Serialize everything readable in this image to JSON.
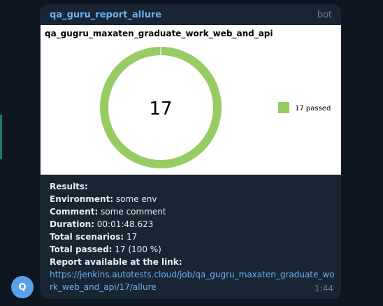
{
  "message": {
    "sender": "qa_guru_report_allure",
    "badge": "bot",
    "time": "1:44"
  },
  "avatar": {
    "letter": "Q"
  },
  "report": {
    "title": "qa_gugru_maxaten_graduate_work_web_and_api",
    "center_label": "17",
    "legend_label": "17 passed"
  },
  "chart_data": {
    "type": "pie",
    "title": "qa_gugru_maxaten_graduate_work_web_and_api",
    "center_label": "17",
    "series": [
      {
        "name": "17 passed",
        "value": 17,
        "color": "#97cc64"
      }
    ],
    "legend_position": "right"
  },
  "results": {
    "heading": "Results:",
    "environment_label": "Environment:",
    "environment_value": " some env",
    "comment_label": "Comment:",
    "comment_value": " some comment",
    "duration_label": "Duration:",
    "duration_value": " 00:01:48.623",
    "total_scenarios_label": "Total scenarios:",
    "total_scenarios_value": " 17",
    "total_passed_label": "Total passed:",
    "total_passed_value": " 17 (100 %)",
    "link_label": "Report available at the link:",
    "link_url": "https://jenkins.autotests.cloud/job/qa_gugru_maxaten_graduate_work_web_and_api/17/allure"
  },
  "colors": {
    "background": "#0e1621",
    "bubble": "#182533",
    "accent": "#6ab2f2",
    "passed": "#97cc64"
  }
}
